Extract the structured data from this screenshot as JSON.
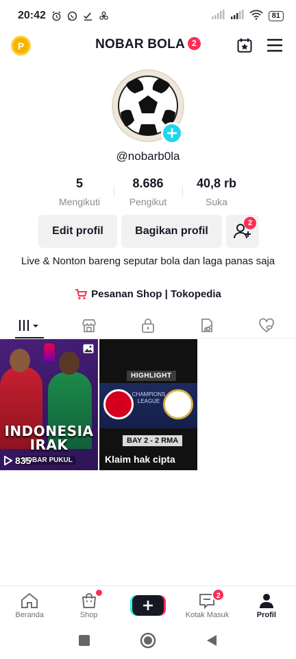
{
  "status_bar": {
    "time": "20:42",
    "battery": "81"
  },
  "header": {
    "coin_letter": "P",
    "title": "NOBAR BOLA",
    "title_badge": "2"
  },
  "profile": {
    "username": "@nobarb0la",
    "stats": [
      {
        "value": "5",
        "label": "Mengikuti"
      },
      {
        "value": "8.686",
        "label": "Pengikut"
      },
      {
        "value": "40,8 rb",
        "label": "Suka"
      }
    ],
    "edit_label": "Edit profil",
    "share_label": "Bagikan profil",
    "add_friend_badge": "2",
    "bio": "Live & Nonton bareng seputar bola dan laga panas saja",
    "shop_link": "Pesanan Shop | Tokopedia"
  },
  "videos": [
    {
      "overlay_title": "INDONESIA IRAK",
      "overlay_sub": "NOBAR PUKUL",
      "views": "835"
    },
    {
      "highlight_label": "HIGHLIGHT",
      "competition": "CHAMPIONS LEAGUE",
      "score": "BAY 2 - 2 RMA",
      "caption": "Klaim hak cipta"
    }
  ],
  "bottom_nav": {
    "items": [
      {
        "label": "Beranda"
      },
      {
        "label": "Shop"
      },
      {
        "label": ""
      },
      {
        "label": "Kotak Masuk",
        "badge": "2"
      },
      {
        "label": "Profil"
      }
    ]
  },
  "colors": {
    "accent_red": "#fe2c55",
    "accent_cyan": "#20d5ec",
    "coin": "#f4b400"
  }
}
